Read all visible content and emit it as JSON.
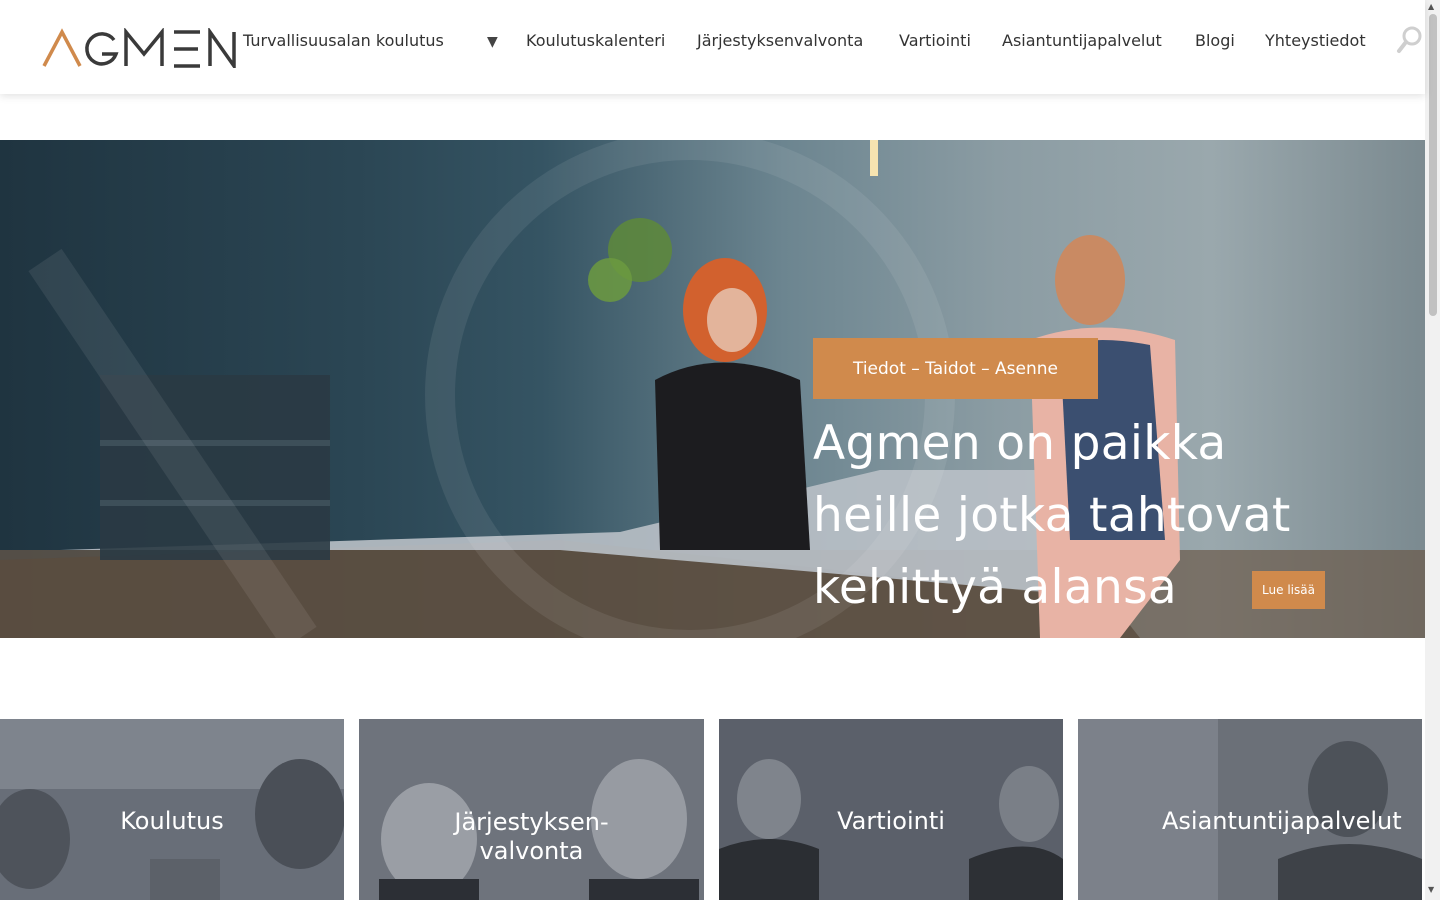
{
  "brand": {
    "logo_text": "AGMEN",
    "accent": "#d08a4c"
  },
  "nav": {
    "items": [
      {
        "label": "Turvallisuusalan koulutus"
      },
      {
        "label": "Koulutuskalenteri"
      },
      {
        "label": "Järjestyksenvalvonta"
      },
      {
        "label": "Vartiointi"
      },
      {
        "label": "Asiantuntijapalvelut"
      },
      {
        "label": "Blogi"
      },
      {
        "label": "Yhteystiedot"
      }
    ],
    "dropdown_icon": "caret-down-icon",
    "search_icon": "search-icon"
  },
  "hero": {
    "tag": "Tiedot – Taidot – Asenne",
    "title": "Agmen on paikka heille jotka tahtovat kehittyä alansa parhaiksi",
    "button": "Lue lisää"
  },
  "cards": [
    {
      "label": "Koulutus"
    },
    {
      "label": "Järjestyksen-\nvalvonta"
    },
    {
      "label": "Vartiointi"
    },
    {
      "label": "Asiantuntijapalvelut"
    }
  ]
}
